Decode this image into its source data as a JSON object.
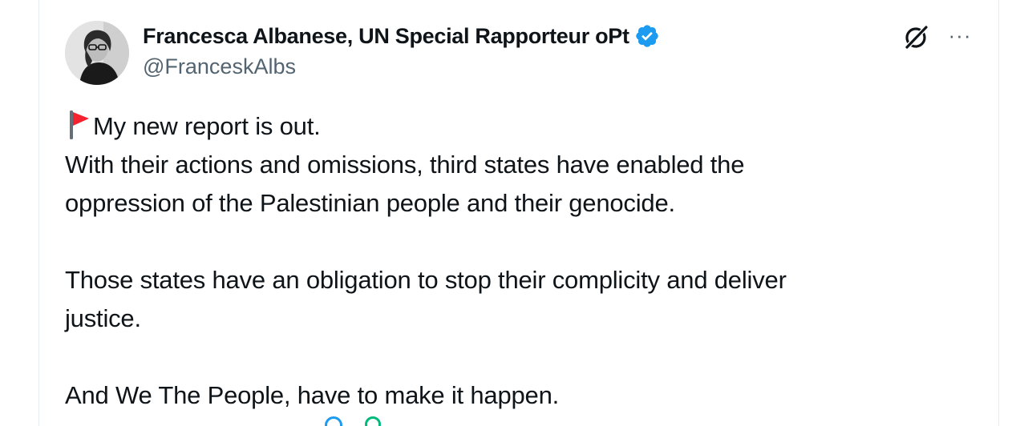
{
  "tweet": {
    "author": {
      "display_name": "Francesca Albanese, UN Special Rapporteur oPt",
      "handle": "@FranceskAlbs",
      "verified": true,
      "avatar_icon": "profile-photo"
    },
    "header_icons": {
      "grok": "grok-icon",
      "more": "···"
    },
    "text_lines": [
      "My new report is out.",
      "With their actions and omissions, third states have enabled the",
      "oppression of the Palestinian people and their genocide.",
      "",
      "Those states have an obligation to stop their complicity and deliver",
      "justice.",
      "",
      "And We The People, have to make it happen."
    ],
    "colors": {
      "verified": "#1d9bf0",
      "secondary_text": "#536471",
      "flag_red": "#f4212e"
    }
  }
}
